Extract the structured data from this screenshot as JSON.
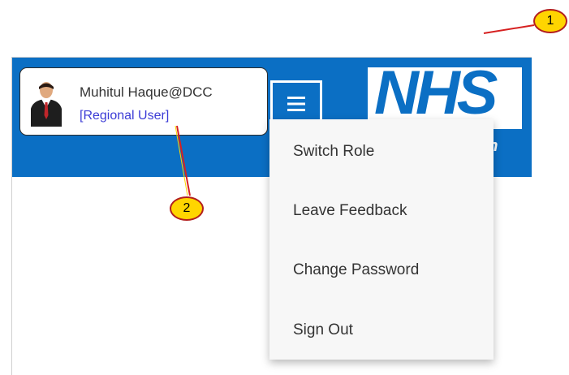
{
  "header": {
    "user_name": "Muhitul Haque@DCC",
    "user_role": "[Regional User]",
    "logo_text": "NHS",
    "logo_subtext": "on",
    "brand_color": "#0b6fc4"
  },
  "menu": {
    "icon": "hamburger-icon",
    "items": [
      {
        "label": "Switch Role"
      },
      {
        "label": "Leave Feedback"
      },
      {
        "label": "Change Password"
      },
      {
        "label": "Sign Out"
      }
    ]
  },
  "callouts": [
    {
      "label": "1"
    },
    {
      "label": "2"
    }
  ],
  "colors": {
    "callout_fill": "#ffd500",
    "callout_line": "#d62020",
    "role_link": "#3c3cd6"
  }
}
